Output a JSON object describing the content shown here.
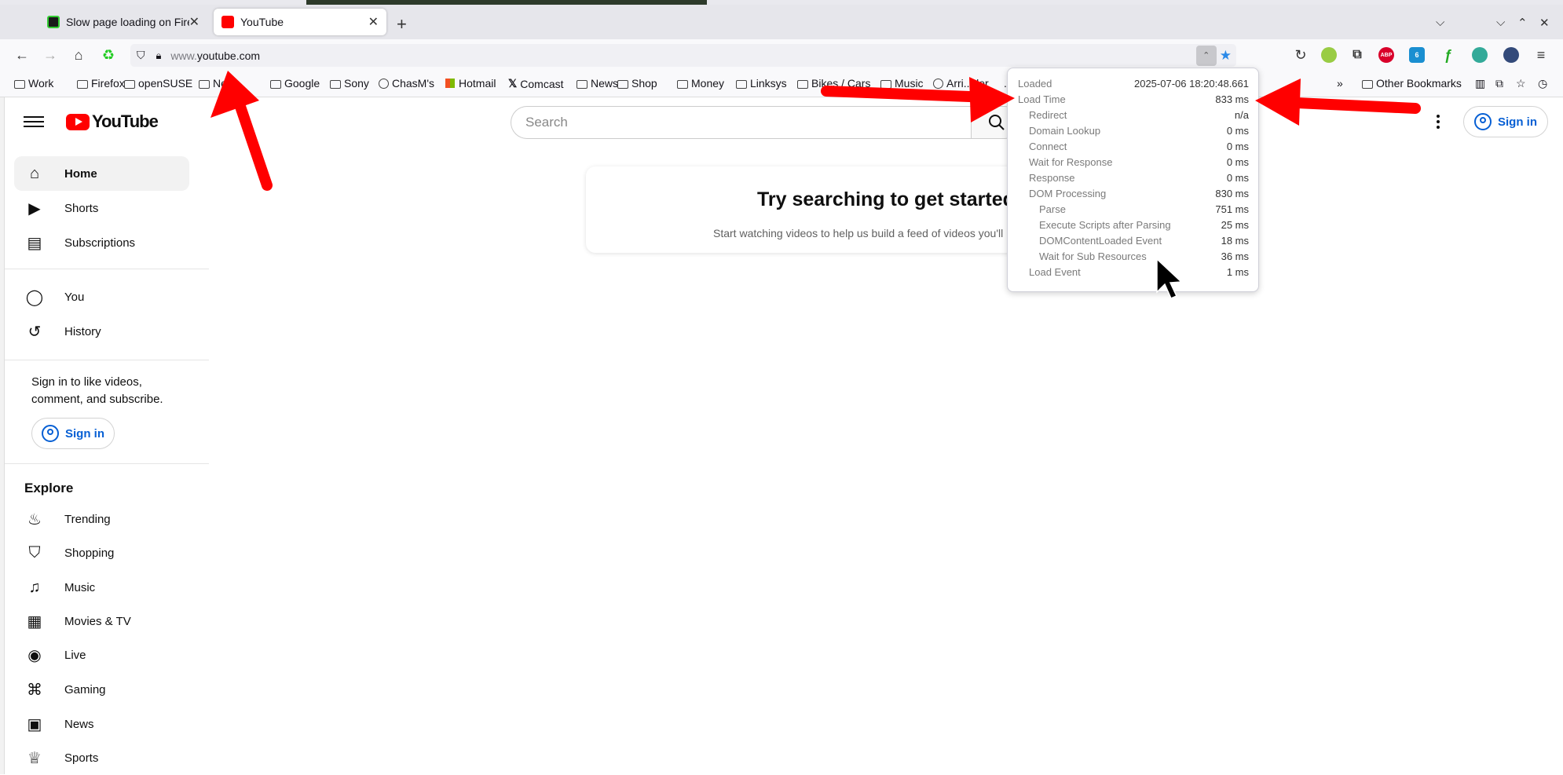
{
  "browser": {
    "tabs": [
      {
        "label": "Slow page loading on Firef",
        "favicon_color": "#1a1a1a",
        "active": false
      },
      {
        "label": "YouTube",
        "favicon_color": "#ff0000",
        "active": true
      }
    ],
    "url_prefix": "www.",
    "url_host": "youtube.com",
    "ext_badge": "6",
    "ext_abp": "ABP",
    "bookmarks": [
      {
        "label": "Work",
        "icon": "folder-icon"
      },
      {
        "label": "Firefox",
        "icon": "folder-icon"
      },
      {
        "label": "openSUSE",
        "icon": "folder-icon"
      },
      {
        "label": "Net...",
        "icon": "folder-icon"
      },
      {
        "label": "Google",
        "icon": "folder-icon"
      },
      {
        "label": "Sony",
        "icon": "folder-icon"
      },
      {
        "label": "ChasM's",
        "icon": "globe-icon"
      },
      {
        "label": "Hotmail",
        "icon": "microsoft-icon"
      },
      {
        "label": "Comcast",
        "icon": "x-icon"
      },
      {
        "label": "News",
        "icon": "folder-icon"
      },
      {
        "label": "Shop",
        "icon": "folder-icon"
      },
      {
        "label": "Money",
        "icon": "folder-icon"
      },
      {
        "label": "Linksys",
        "icon": "folder-icon"
      },
      {
        "label": "Bikes / Cars",
        "icon": "folder-icon"
      },
      {
        "label": "Music",
        "icon": "folder-icon"
      },
      {
        "label": "Arri...der",
        "icon": "globe-icon"
      },
      {
        "label": "...ating",
        "icon": "none"
      }
    ],
    "other_bookmarks": "Other Bookmarks",
    "overflow_glyph": "»"
  },
  "youtube": {
    "logo_text": "YouTube",
    "search_placeholder": "Search",
    "sign_in": "Sign in",
    "sidebar_main": [
      {
        "label": "Home",
        "icon": "home-icon",
        "active": true
      },
      {
        "label": "Shorts",
        "icon": "shorts-icon"
      },
      {
        "label": "Subscriptions",
        "icon": "subscriptions-icon"
      }
    ],
    "sidebar_you": [
      {
        "label": "You",
        "icon": "user-circle-icon"
      },
      {
        "label": "History",
        "icon": "history-icon"
      }
    ],
    "sign_in_message": "Sign in to like videos, comment, and subscribe.",
    "explore_title": "Explore",
    "explore_items": [
      {
        "label": "Trending",
        "icon": "trending-icon"
      },
      {
        "label": "Shopping",
        "icon": "shopping-bag-icon"
      },
      {
        "label": "Music",
        "icon": "music-note-icon"
      },
      {
        "label": "Movies & TV",
        "icon": "clapperboard-icon"
      },
      {
        "label": "Live",
        "icon": "live-icon"
      },
      {
        "label": "Gaming",
        "icon": "gamepad-icon"
      },
      {
        "label": "News",
        "icon": "newspaper-icon"
      },
      {
        "label": "Sports",
        "icon": "trophy-icon"
      }
    ],
    "card_title": "Try searching to get started",
    "card_subtitle": "Start watching videos to help us build a feed of videos you'll like."
  },
  "load_popup": {
    "rows": [
      {
        "label": "Loaded",
        "value": "2025-07-06 18:20:48.661",
        "indent": 0
      },
      {
        "label": "Load Time",
        "value": "833 ms",
        "indent": 0
      },
      {
        "label": "Redirect",
        "value": "n/a",
        "indent": 1
      },
      {
        "label": "Domain Lookup",
        "value": "0 ms",
        "indent": 1
      },
      {
        "label": "Connect",
        "value": "0 ms",
        "indent": 1
      },
      {
        "label": "Wait for Response",
        "value": "0 ms",
        "indent": 1
      },
      {
        "label": "Response",
        "value": "0 ms",
        "indent": 1
      },
      {
        "label": "DOM Processing",
        "value": "830 ms",
        "indent": 1
      },
      {
        "label": "Parse",
        "value": "751 ms",
        "indent": 2
      },
      {
        "label": "Execute Scripts after Parsing",
        "value": "25 ms",
        "indent": 2
      },
      {
        "label": "DOMContentLoaded Event",
        "value": "18 ms",
        "indent": 2
      },
      {
        "label": "Wait for Sub Resources",
        "value": "36 ms",
        "indent": 2
      },
      {
        "label": "Load Event",
        "value": "1 ms",
        "indent": 1
      }
    ]
  },
  "colors": {
    "annotation_arrow": "#ff0000",
    "yt_red": "#ff0000",
    "link_blue": "#065fd4"
  }
}
